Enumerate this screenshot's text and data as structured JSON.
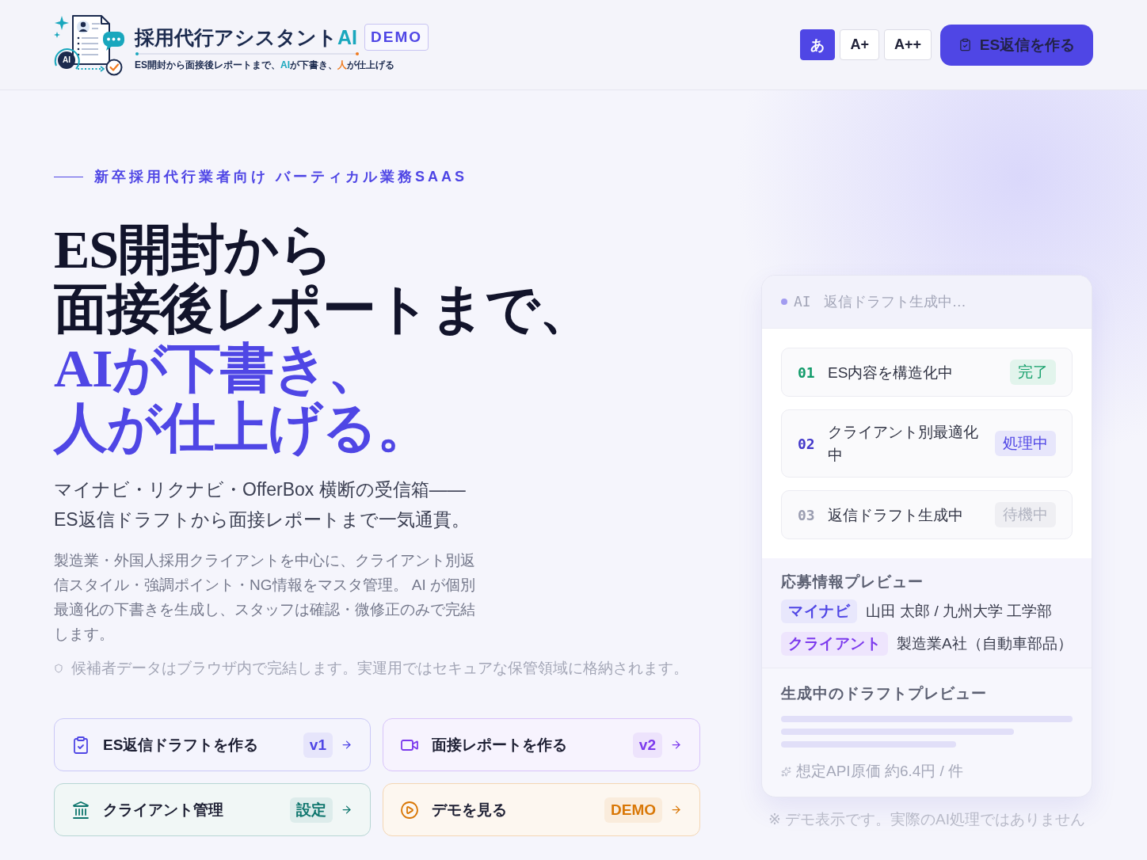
{
  "header": {
    "logo": {
      "badge": "AI",
      "title": "採用代行アシスタント",
      "title_accent": "AI",
      "tagline": [
        {
          "kind": "plain",
          "text": "ES開封から面接後レポートまで、"
        },
        {
          "kind": "ai",
          "text": "AI"
        },
        {
          "kind": "plain",
          "text": "が下書き、"
        },
        {
          "kind": "human",
          "text": "人"
        },
        {
          "kind": "plain",
          "text": "が仕上げる"
        }
      ]
    },
    "demo_badge": "DEMO",
    "font_sizes": [
      {
        "label": "あ",
        "selected": true
      },
      {
        "label": "A+",
        "selected": false
      },
      {
        "label": "A++",
        "selected": false
      }
    ],
    "cta": "ES返信を作る"
  },
  "hero": {
    "eyebrow": "新卒採用代行業者向け バーティカル業務SAAS",
    "headline": [
      {
        "kind": "plain",
        "text": "ES開封から"
      },
      {
        "kind": "plain",
        "text": "面接後レポートまで、"
      },
      {
        "kind": "accent",
        "text": "AIが下書き、"
      },
      {
        "kind": "accent",
        "text": "人が仕上げる。"
      }
    ],
    "lead": [
      "マイナビ・リクナビ・OfferBox 横断の受信箱——",
      "ES返信ドラフトから面接レポートまで一気通貫。"
    ],
    "description": "製造業・外国人採用クライアントを中心に、クライアント別返信スタイル・強調ポイント・NG情報をマスタ管理。 AI が個別最適化の下書きを生成し、スタッフは確認・微修正のみで完結します。",
    "privacy_note": "候補者データはブラウザ内で完結します。実運用ではセキュアな保管領域に格納されます。",
    "actions": [
      {
        "label": "ES返信ドラフトを作る",
        "tag": "v1",
        "color": "#4f46e5"
      },
      {
        "label": "面接レポートを作る",
        "tag": "v2",
        "color": "#7c3aed"
      },
      {
        "label": "クライアント管理",
        "tag": "設定",
        "color": "#0f766e"
      },
      {
        "label": "デモを見る",
        "tag": "DEMO",
        "color": "#d97706"
      }
    ]
  },
  "preview_card": {
    "status": {
      "prefix": "AI",
      "text": "返信ドラフト生成中…"
    },
    "steps": [
      {
        "number": "01",
        "label": "ES内容を構造化中",
        "status": "完了",
        "kind": "done"
      },
      {
        "number": "02",
        "label": "クライアント別最適化中",
        "status": "処理中",
        "kind": "active"
      },
      {
        "number": "03",
        "label": "返信ドラフト生成中",
        "status": "待機中",
        "kind": "waiting"
      }
    ],
    "application": {
      "title": "応募情報プレビュー",
      "rows": [
        {
          "tag": "マイナビ",
          "color": "#4f46e5",
          "value": "山田 太郎 / 九州大学 工学部"
        },
        {
          "tag": "クライアント",
          "color": "#7c3aed",
          "value": "製造業A社（自動車部品）"
        }
      ]
    },
    "draft": {
      "title": "生成中のドラフトプレビュー",
      "cost_note": "想定API原価 約6.4円 / 件"
    }
  },
  "demo_note": "※ デモ表示です。実際のAI処理ではありません"
}
